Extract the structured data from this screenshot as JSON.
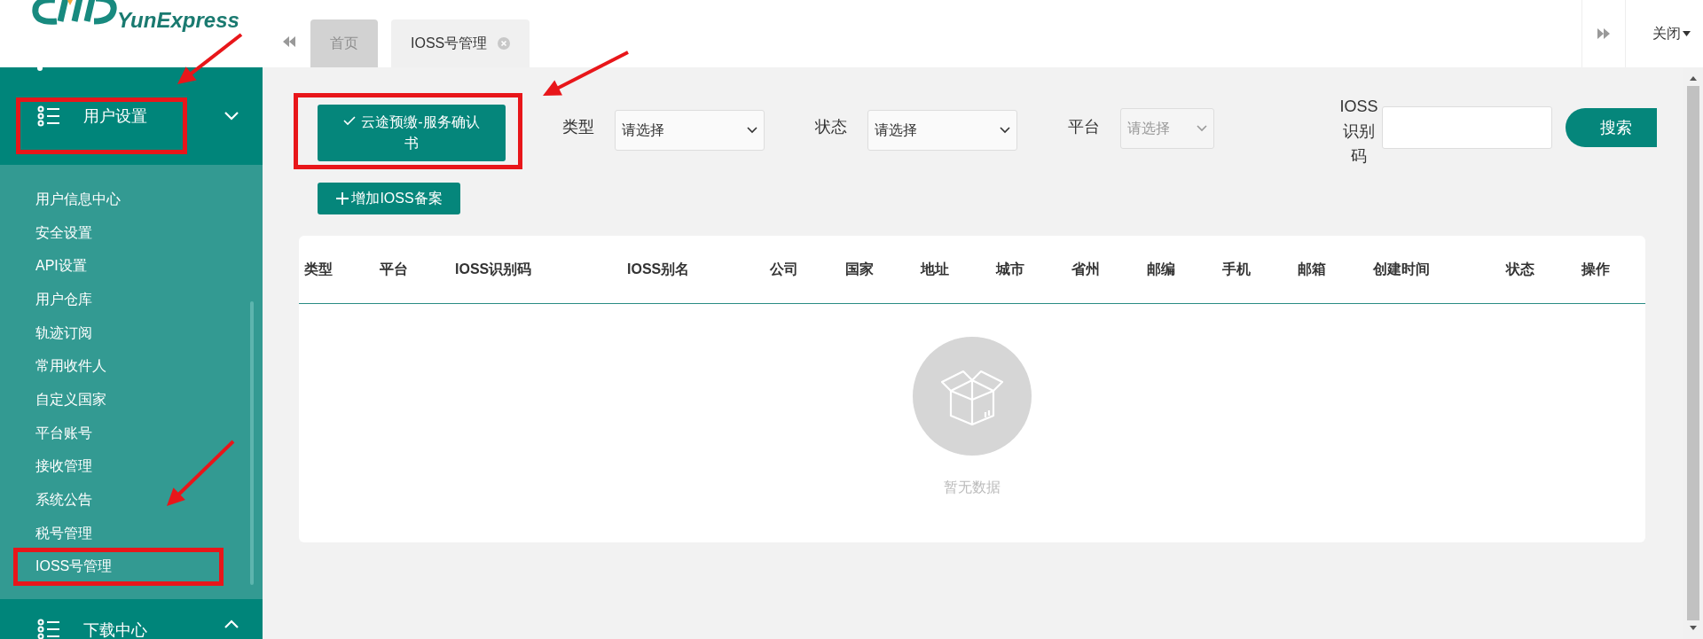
{
  "logo": {
    "text": "YunExpress"
  },
  "tabs": [
    {
      "label": "首页",
      "selected": false,
      "closable": false
    },
    {
      "label": "IOSS号管理",
      "selected": true,
      "closable": true
    }
  ],
  "close_menu": "关闭",
  "sidebar": {
    "groups": [
      {
        "label": "用户设置",
        "expanded": true,
        "items": [
          "用户信息中心",
          "安全设置",
          "API设置",
          "用户仓库",
          "轨迹订阅",
          "常用收件人",
          "自定义国家",
          "平台账号",
          "接收管理",
          "系统公告",
          "税号管理",
          "IOSS号管理"
        ]
      },
      {
        "label": "下载中心",
        "expanded": false
      }
    ]
  },
  "confirm_button": "云途预缴-服务确认书",
  "add_button": "增加IOSS备案",
  "filters": [
    {
      "label": "类型",
      "placeholder": "请选择",
      "disabled": false
    },
    {
      "label": "状态",
      "placeholder": "请选择",
      "disabled": false
    },
    {
      "label": "平台",
      "placeholder": "请选择",
      "disabled": true
    }
  ],
  "ioss_field": {
    "label": "IOSS识别码"
  },
  "search_button": "搜索",
  "table": {
    "columns": [
      "类型",
      "平台",
      "IOSS识别码",
      "IOSS别名",
      "公司",
      "国家",
      "地址",
      "城市",
      "省州",
      "邮编",
      "手机",
      "邮箱",
      "创建时间",
      "状态",
      "操作"
    ],
    "empty_text": "暂无数据"
  }
}
